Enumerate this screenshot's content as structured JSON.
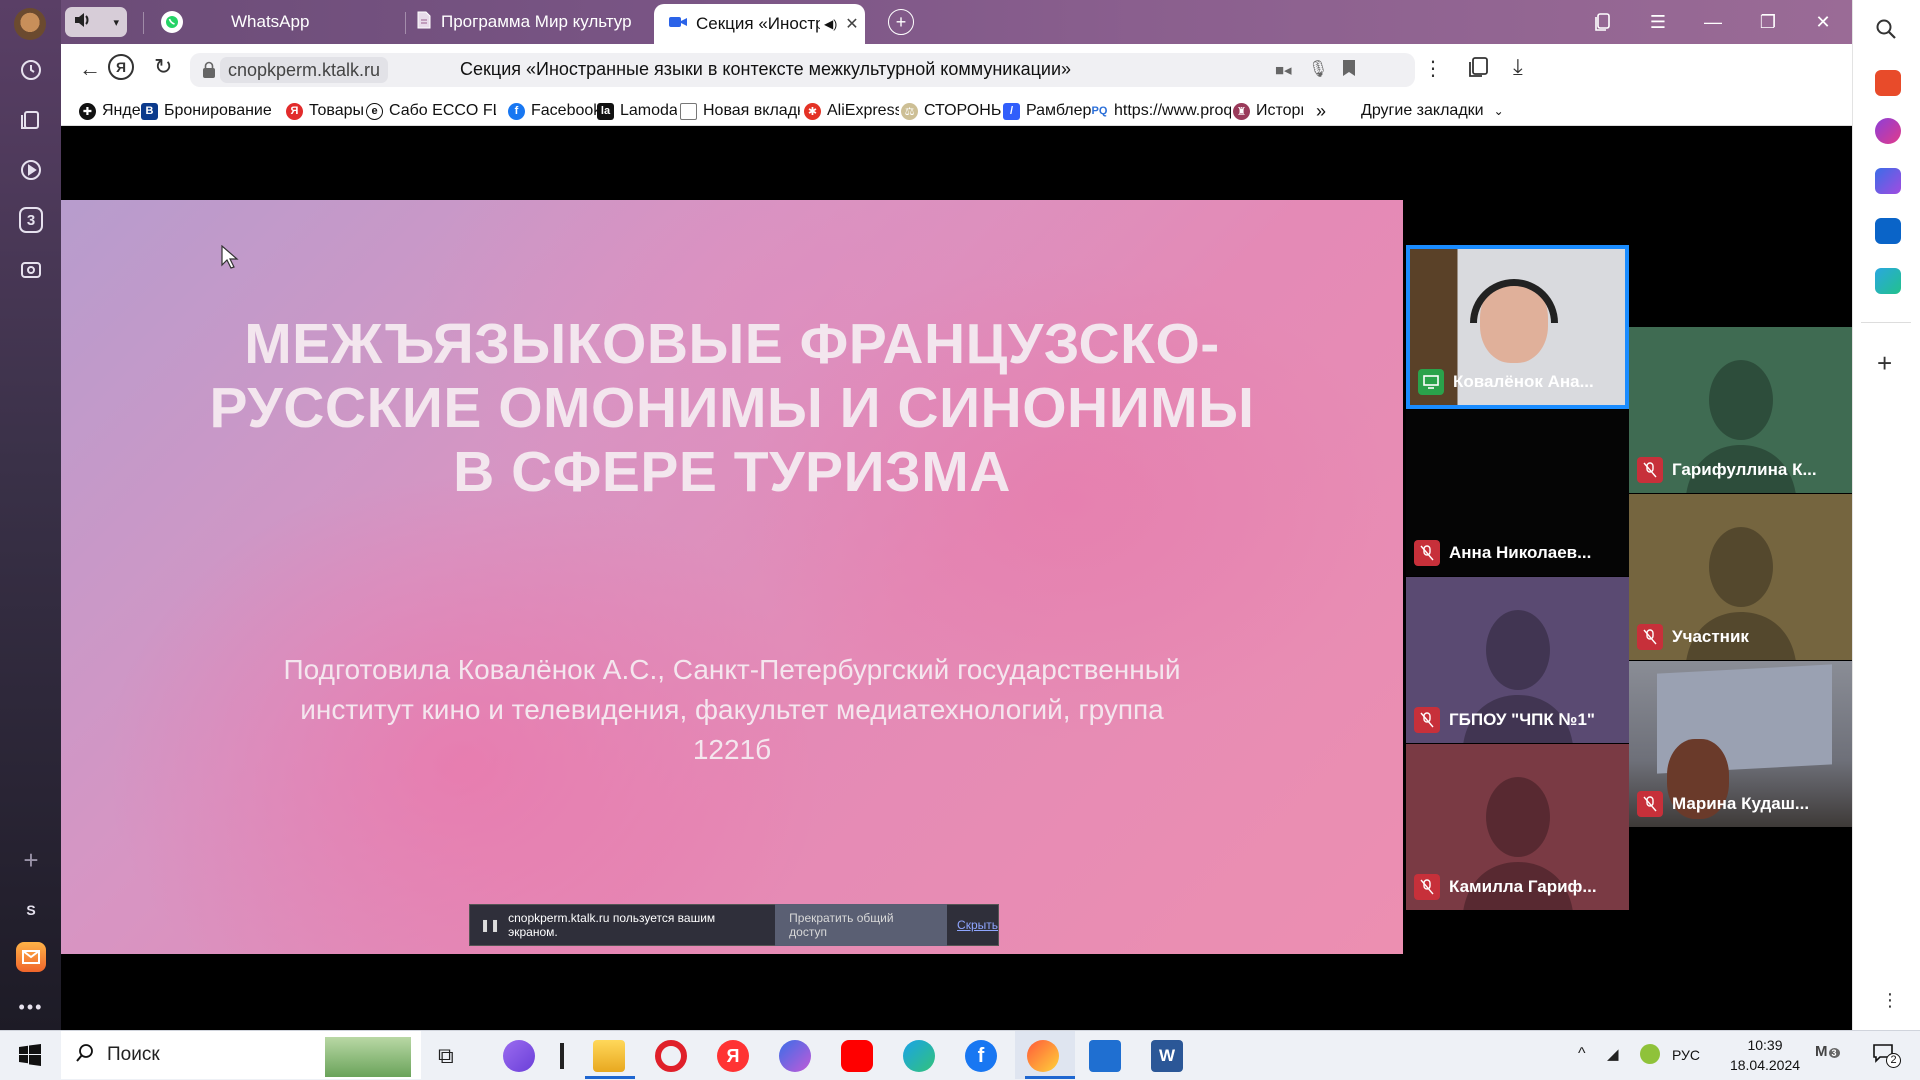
{
  "browser": {
    "tabs": [
      {
        "label": "WhatsApp"
      },
      {
        "label": "Программа Мир культуры"
      },
      {
        "label": "Секция «Иностранные языки в контексте межкультурной коммуникации»"
      }
    ],
    "address": "cnopkperm.ktalk.ru",
    "page_title": "Секция «Иностранные языки в контексте межкультурной коммуникации»",
    "bookmarks": [
      {
        "label": "Яндекс",
        "color": "#111111"
      },
      {
        "label": "Бронирование от",
        "color": "#0b3a8c"
      },
      {
        "label": "Товары",
        "color": "#e22b2b"
      },
      {
        "label": "Сабо ECCO FLOW",
        "color": "#111111"
      },
      {
        "label": "Facebook",
        "color": "#1877f2"
      },
      {
        "label": "Lamoda",
        "color": "#111111"
      },
      {
        "label": "Новая вкладка",
        "color": "#777777"
      },
      {
        "label": "AliExpress",
        "color": "#e43225"
      },
      {
        "label": "СТОРОНЫ",
        "color": "#9a8a5a"
      },
      {
        "label": "Рамблер",
        "color": "#315efb"
      },
      {
        "label": "https://www.proq",
        "color": "#2a6ed8"
      },
      {
        "label": "Истори",
        "color": "#9a3a5a"
      }
    ],
    "bookmarks_more": "»",
    "other_bookmarks": "Другие закладки",
    "sidebar_tab_count": "3",
    "sidebar_letter": "S"
  },
  "slide": {
    "title": "МЕЖЪЯЗЫКОВЫЕ ФРАНЦУЗСКО-РУССКИЕ ОМОНИМЫ И СИНОНИМЫ В СФЕРЕ ТУРИЗМА",
    "subtitle": "Подготовила Ковалёнок А.С., Санкт-Петербургский государственный институт кино и телевидения, факультет медиатехнологий, группа 1221б"
  },
  "share_bar": {
    "text": "cnopkperm.ktalk.ru пользуется вашим экраном.",
    "stop_label": "Прекратить общий доступ",
    "hide_label": "Скрыть"
  },
  "participants": [
    {
      "name": "Ковалёнок Ана...",
      "status": "sharing",
      "bg": "#2a2a2a"
    },
    {
      "name": "Гарифуллина К...",
      "status": "muted",
      "bg": "#3f6b52"
    },
    {
      "name": "Анна Николаев...",
      "status": "muted",
      "bg": "#050505"
    },
    {
      "name": "Участник",
      "status": "muted",
      "bg": "#75653f"
    },
    {
      "name": "ГБПОУ \"ЧПК №1\"",
      "status": "muted",
      "bg": "#5a4a72"
    },
    {
      "name": "Марина Кудаш...",
      "status": "muted",
      "bg": "#6a6a72"
    },
    {
      "name": "Камилла Гариф...",
      "status": "muted",
      "bg": "#7a3a44"
    }
  ],
  "taskbar": {
    "search_placeholder": "Поиск",
    "language": "РУС",
    "time": "10:39",
    "date": "18.04.2024",
    "notification_count": "2",
    "badge_count": "3"
  }
}
